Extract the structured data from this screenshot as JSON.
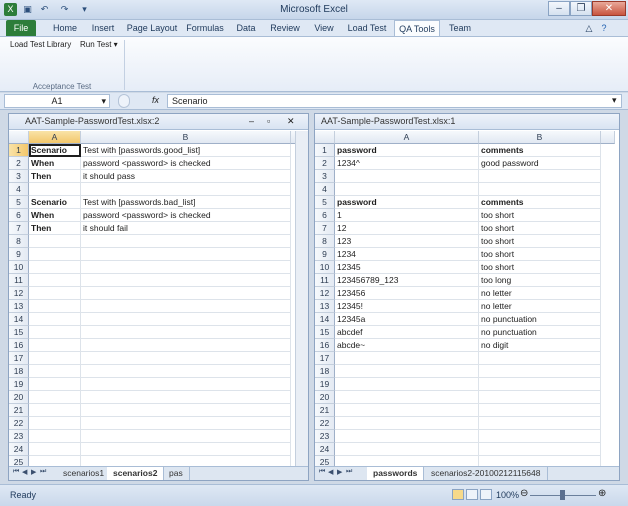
{
  "window": {
    "title": "Microsoft Excel"
  },
  "ribbon": {
    "tabs": [
      "File",
      "Home",
      "Insert",
      "Page Layout",
      "Formulas",
      "Data",
      "Review",
      "View",
      "Load Test",
      "QA Tools",
      "Team"
    ],
    "active_tab": "QA Tools",
    "buttons": {
      "load_library": "Load Test Library",
      "run_test": "Run Test"
    },
    "group_label": "Acceptance Test"
  },
  "formula_bar": {
    "name_box": "A1",
    "fx": "fx",
    "value": "Scenario"
  },
  "left_pane": {
    "title": "AAT-Sample-PasswordTest.xlsx:2",
    "columns": [
      "A",
      "B"
    ],
    "rows": [
      [
        "Scenario",
        "Test with [passwords.good_list]"
      ],
      [
        "When",
        "password <password> is checked"
      ],
      [
        "Then",
        "it should pass"
      ],
      [
        "",
        ""
      ],
      [
        "Scenario",
        "Test with [passwords.bad_list]"
      ],
      [
        "When",
        "password <password> is checked"
      ],
      [
        "Then",
        "it should fail"
      ]
    ],
    "row_numbers": [
      "1",
      "2",
      "3",
      "4",
      "5",
      "6",
      "7",
      "8",
      "9",
      "10",
      "11",
      "12",
      "13",
      "14",
      "15",
      "16",
      "17",
      "18",
      "19",
      "20",
      "21",
      "22",
      "23",
      "24",
      "25"
    ],
    "sheet_tabs": [
      "scenarios1",
      "scenarios2",
      "pas"
    ],
    "active_sheet": "scenarios2"
  },
  "right_pane": {
    "title": "AAT-Sample-PasswordTest.xlsx:1",
    "columns": [
      "A",
      "B"
    ],
    "rows": [
      [
        "password",
        "comments"
      ],
      [
        "1234^",
        "good password"
      ],
      [
        "",
        ""
      ],
      [
        "",
        ""
      ],
      [
        "password",
        "comments"
      ],
      [
        "1",
        "too short"
      ],
      [
        "12",
        "too short"
      ],
      [
        "123",
        "too short"
      ],
      [
        "1234",
        "too short"
      ],
      [
        "12345",
        "too short"
      ],
      [
        "123456789_123",
        "too long"
      ],
      [
        "123456",
        "no letter"
      ],
      [
        "12345!",
        "no letter"
      ],
      [
        "12345a",
        "no punctuation"
      ],
      [
        "abcdef",
        "no punctuation"
      ],
      [
        "abcde~",
        "no digit"
      ]
    ],
    "row_numbers": [
      "1",
      "2",
      "3",
      "4",
      "5",
      "6",
      "7",
      "8",
      "9",
      "10",
      "11",
      "12",
      "13",
      "14",
      "15",
      "16",
      "17",
      "18",
      "19",
      "20",
      "21",
      "22",
      "23",
      "24",
      "25"
    ],
    "sheet_tabs": [
      "passwords",
      "scenarios2-20100212115648"
    ],
    "active_sheet": "passwords"
  },
  "status_bar": {
    "status": "Ready",
    "zoom": "100%"
  },
  "colors": {
    "file_tab": "#2d7d3a",
    "selected_header": "#f3c76b",
    "chrome": "#dfe8f4"
  }
}
